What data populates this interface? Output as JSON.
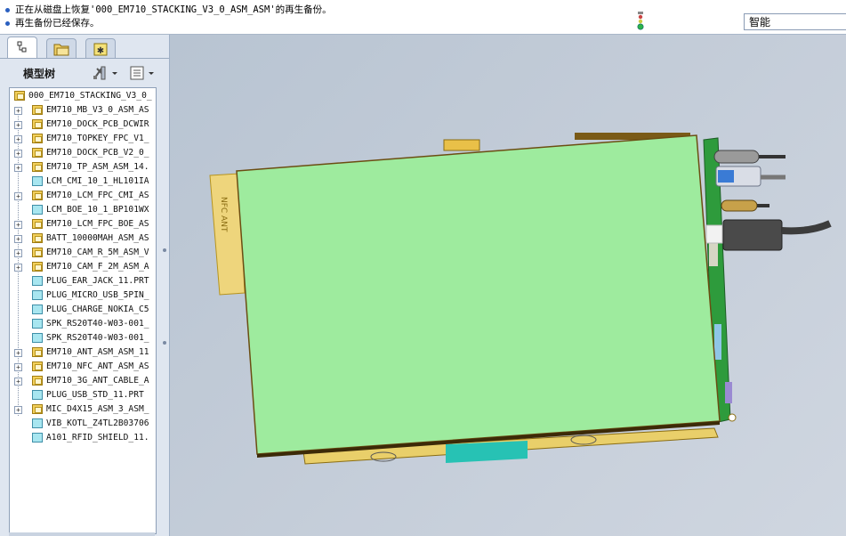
{
  "messages": [
    {
      "text": "正在从磁盘上恢复'000_EM710_STACKING_V3_0_ASM_ASM'的再生备份。"
    },
    {
      "text": "再生备份已经保存。"
    }
  ],
  "smart_filter": {
    "value": "智能"
  },
  "left_panel": {
    "tabs": [
      "model-tree-tab-icon",
      "folder-browser-tab-icon",
      "favorites-tab-icon"
    ],
    "tree_title": "模型树",
    "tools_icon": "tree-tools-icon",
    "show_icon": "tree-show-icon"
  },
  "model_tree": {
    "root": "000_EM710_STACKING_V3_0_",
    "items": [
      {
        "label": "EM710_MB_V3_0_ASM_AS",
        "type": "asm"
      },
      {
        "label": "EM710_DOCK_PCB_DCWIR",
        "type": "asm"
      },
      {
        "label": "EM710_TOPKEY_FPC_V1_",
        "type": "asm"
      },
      {
        "label": "EM710_DOCK_PCB_V2_0_",
        "type": "asm"
      },
      {
        "label": "EM710_TP_ASM_ASM_14.",
        "type": "asm"
      },
      {
        "label": "LCM_CMI_10_1_HL101IA",
        "type": "prt"
      },
      {
        "label": "EM710_LCM_FPC_CMI_AS",
        "type": "asm"
      },
      {
        "label": "LCM_BOE_10_1_BP101WX",
        "type": "prt"
      },
      {
        "label": "EM710_LCM_FPC_BOE_AS",
        "type": "asm"
      },
      {
        "label": "BATT_10000MAH_ASM_AS",
        "type": "asm"
      },
      {
        "label": "EM710_CAM_R_5M_ASM_V",
        "type": "asm"
      },
      {
        "label": "EM710_CAM_F_2M_ASM_A",
        "type": "asm"
      },
      {
        "label": "PLUG_EAR_JACK_11.PRT",
        "type": "prt"
      },
      {
        "label": "PLUG_MICRO_USB_5PIN_",
        "type": "prt"
      },
      {
        "label": "PLUG_CHARGE_NOKIA_C5",
        "type": "prt"
      },
      {
        "label": "SPK_RS20T40-W03-001_",
        "type": "prt"
      },
      {
        "label": "SPK_RS20T40-W03-001_",
        "type": "prt"
      },
      {
        "label": "EM710_ANT_ASM_ASM_11",
        "type": "asm"
      },
      {
        "label": "EM710_NFC_ANT_ASM_AS",
        "type": "asm"
      },
      {
        "label": "EM710_3G_ANT_CABLE_A",
        "type": "asm"
      },
      {
        "label": "PLUG_USB_STD_11.PRT",
        "type": "prt"
      },
      {
        "label": "MIC_D4X15_ASM_3_ASM_",
        "type": "asm"
      },
      {
        "label": "VIB_KOTL_Z4TL2B03706",
        "type": "prt"
      },
      {
        "label": "A101_RFID_SHIELD_11.",
        "type": "prt"
      }
    ]
  },
  "viewport": {
    "nfc_label": "NFC ANT",
    "colors": {
      "panel": "#9eeb9e",
      "frame": "#e9cf6a",
      "pcb": "#2e9b3c",
      "background": "#c1cad6"
    }
  }
}
